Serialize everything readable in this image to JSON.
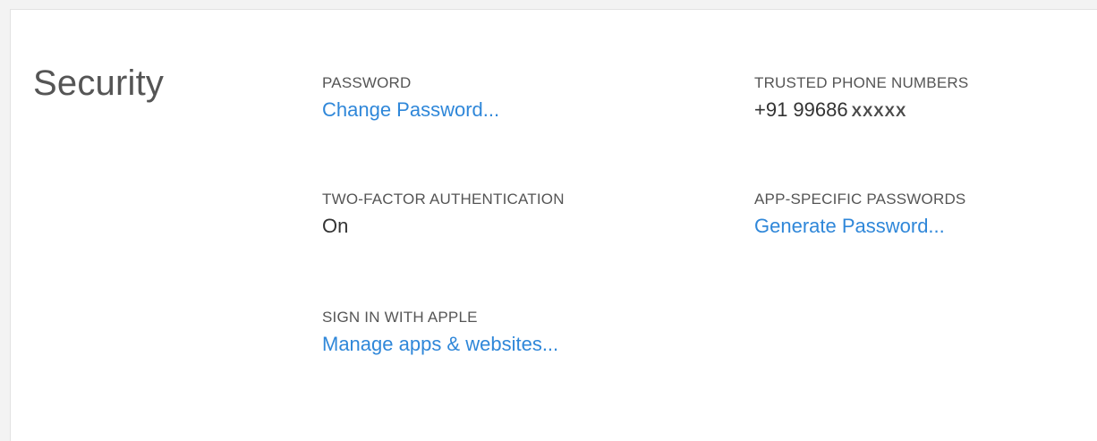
{
  "security": {
    "title": "Security",
    "password": {
      "label": "PASSWORD",
      "action": "Change Password..."
    },
    "two_factor": {
      "label": "TWO-FACTOR AUTHENTICATION",
      "value": "On"
    },
    "sign_in_with_apple": {
      "label": "SIGN IN WITH APPLE",
      "action": "Manage apps & websites..."
    },
    "trusted_phone": {
      "label": "TRUSTED PHONE NUMBERS",
      "number": "+91 99686",
      "masked": "XXXXX"
    },
    "app_specific": {
      "label": "APP-SPECIFIC PASSWORDS",
      "action": "Generate Password..."
    }
  },
  "colors": {
    "link": "#2f87d9",
    "label": "#555555",
    "text": "#333333"
  }
}
